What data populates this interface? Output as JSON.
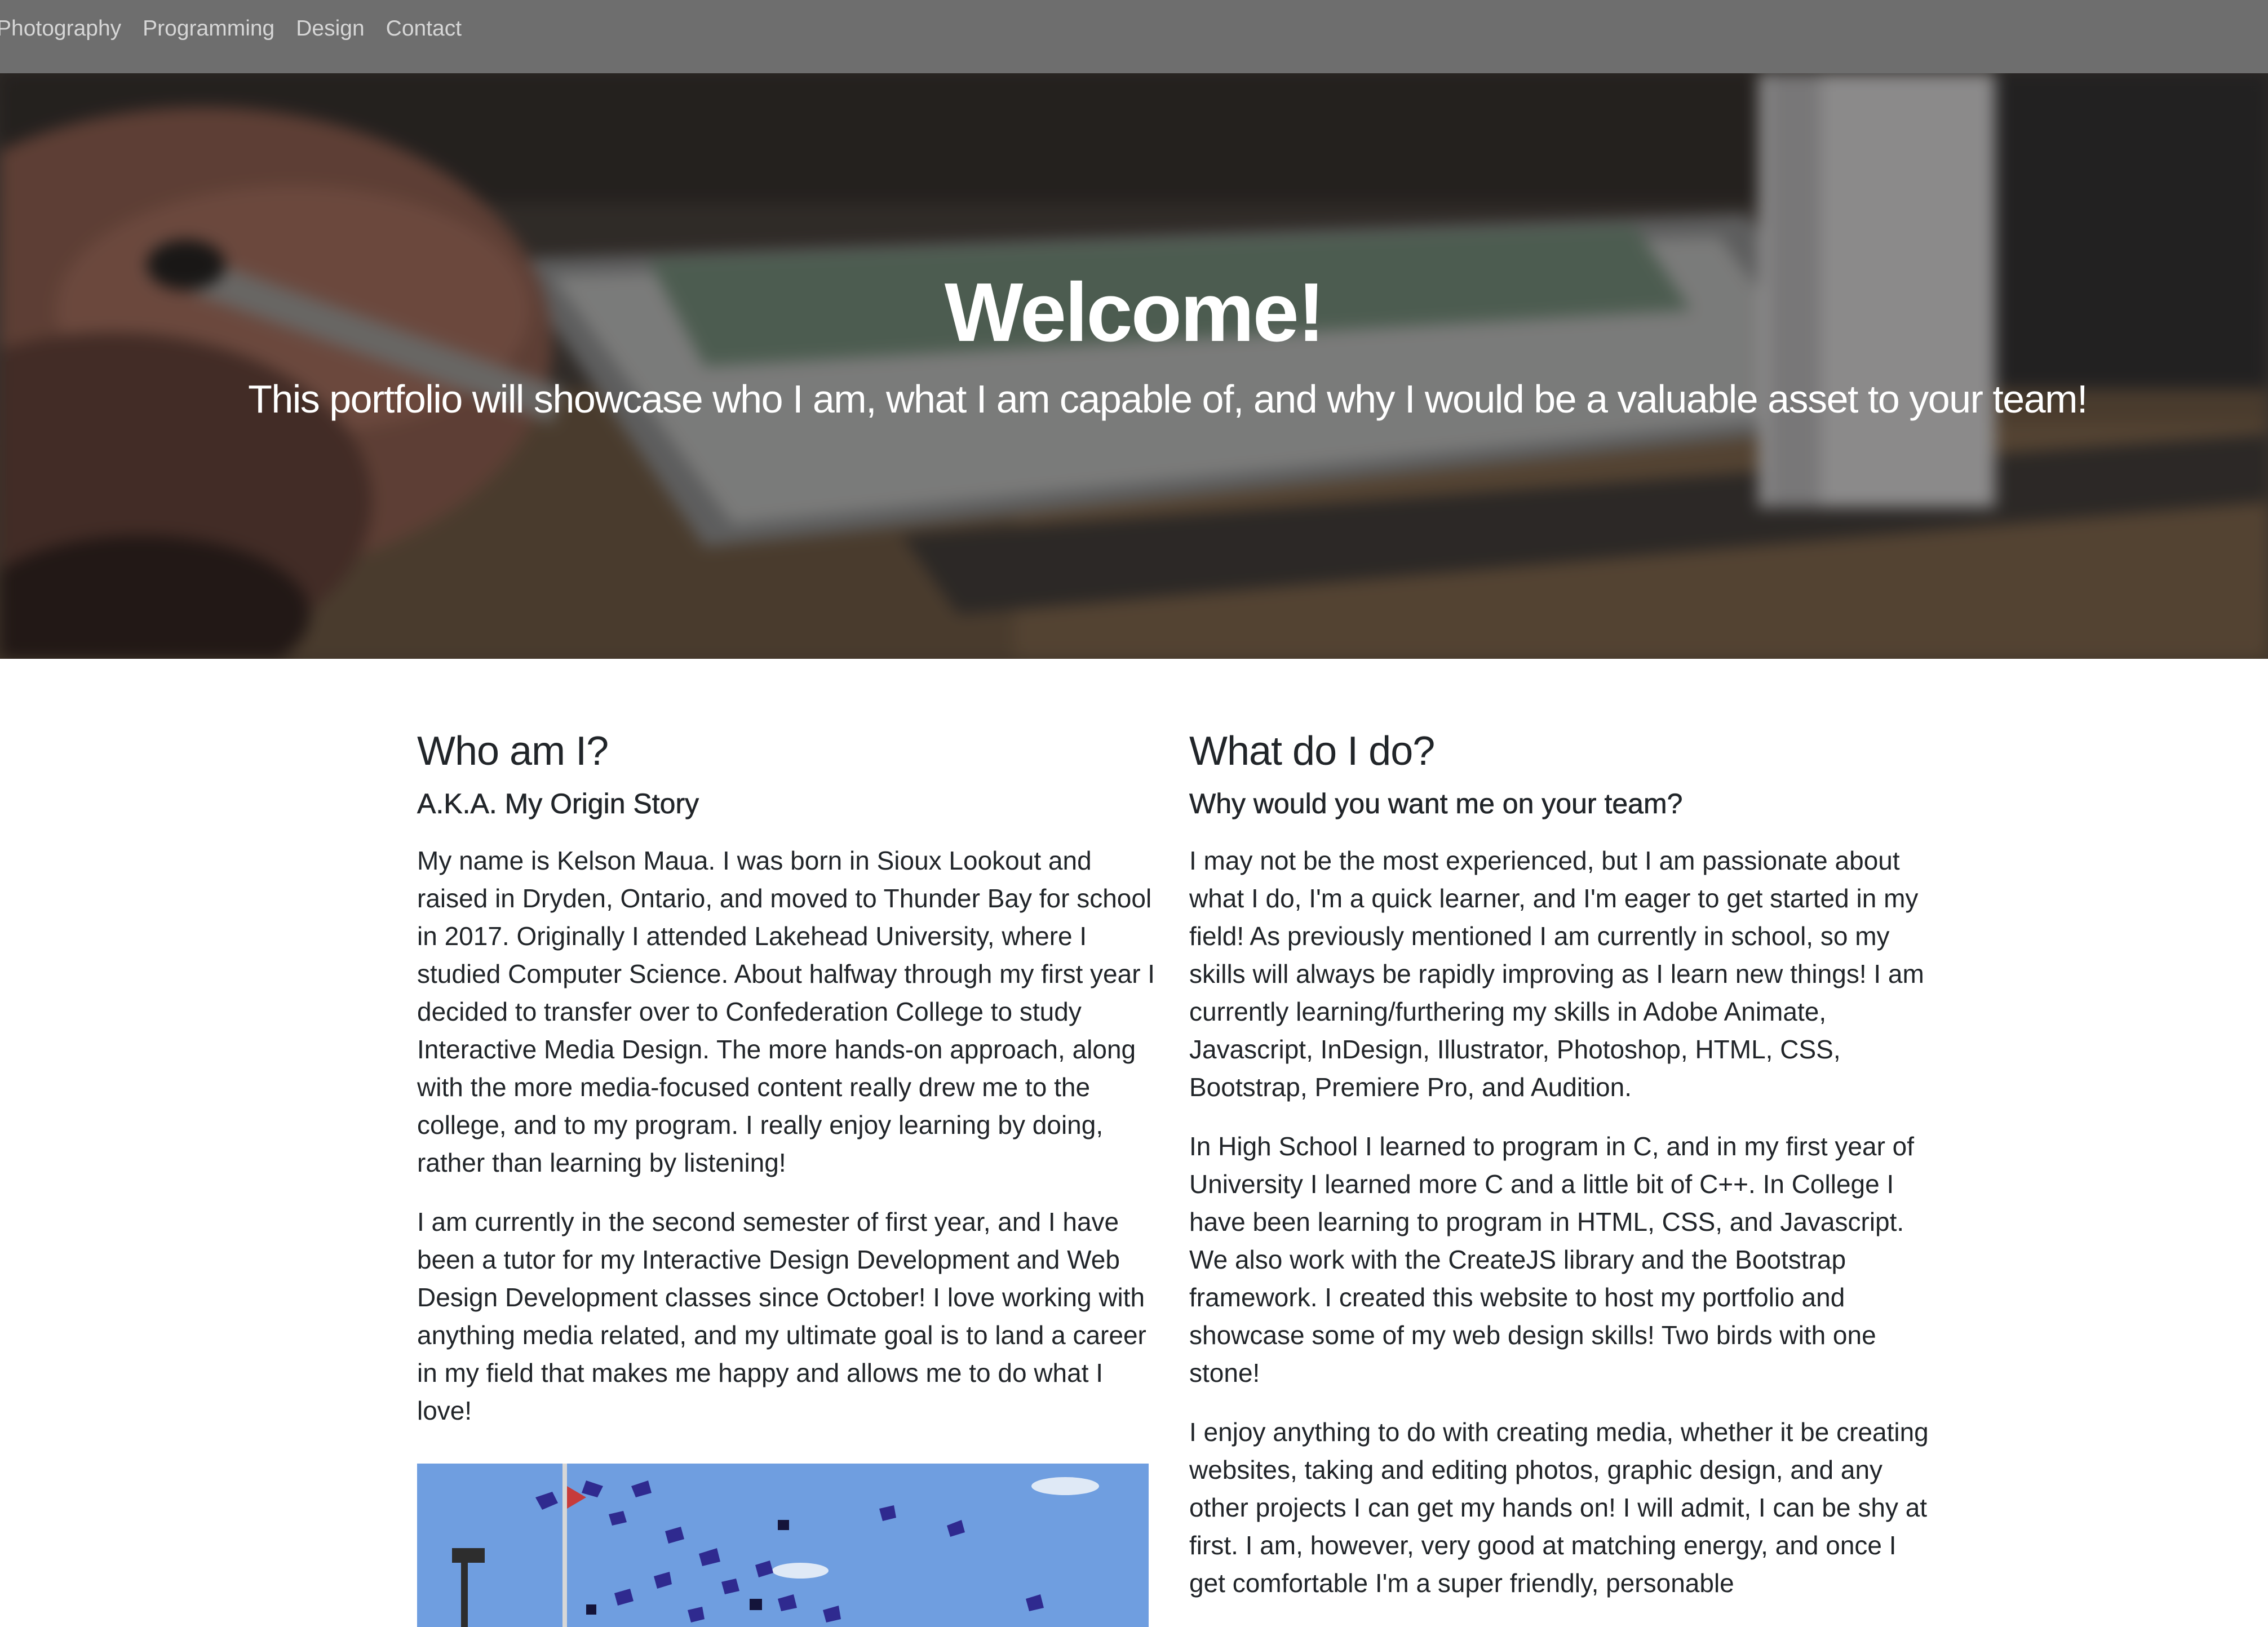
{
  "nav": {
    "items": [
      "Photography",
      "Programming",
      "Design",
      "Contact"
    ]
  },
  "hero": {
    "title": "Welcome!",
    "subtitle": "This portfolio will showcase who I am, what I am capable of, and why I would be a valuable asset to your team!"
  },
  "left": {
    "heading": "Who am I?",
    "subheading": "A.K.A. My Origin Story",
    "paragraphs": [
      "My name is Kelson Maua. I was born in Sioux Lookout and raised in Dryden, Ontario, and moved to Thunder Bay for school in 2017. Originally I attended Lakehead University, where I studied Computer Science. About halfway through my first year I decided to transfer over to Confederation College to study Interactive Media Design. The more hands-on approach, along with the more media-focused content really drew me to the college, and to my program. I really enjoy learning by doing, rather than learning by listening!",
      "I am currently in the second semester of first year, and I have been a tutor for my Interactive Design Development and Web Design Development classes since October! I love working with anything media related, and my ultimate goal is to land a career in my field that makes me happy and allows me to do what I love!"
    ]
  },
  "right": {
    "heading": "What do I do?",
    "subheading": "Why would you want me on your team?",
    "paragraphs": [
      "I may not be the most experienced, but I am passionate about what I do, I'm a quick learner, and I'm eager to get started in my field! As previously mentioned I am currently in school, so my skills will always be rapidly improving as I learn new things! I am currently learning/furthering my skills in Adobe Animate, Javascript, InDesign, Illustrator, Photoshop, HTML, CSS, Bootstrap, Premiere Pro, and Audition.",
      "In High School I learned to program in C, and in my first year of University I learned more C and a little bit of C++. In College I have been learning to program in HTML, CSS, and Javascript. We also work with the CreateJS library and the Bootstrap framework. I created this website to host my portfolio and showcase some of my web design skills! Two birds with one stone!",
      "I enjoy anything to do with creating media, whether it be creating websites, taking and editing photos, graphic design, and any other projects I can get my hands on! I will admit, I can be shy at first. I am, however, very good at matching energy, and once I get comfortable I'm a super friendly, personable"
    ]
  },
  "colors": {
    "navbar_bg": "#6e6e6e",
    "nav_link": "#d6d6d6",
    "text": "#212529",
    "sky": "#6f9ee0",
    "cap": "#2f2a8f"
  }
}
